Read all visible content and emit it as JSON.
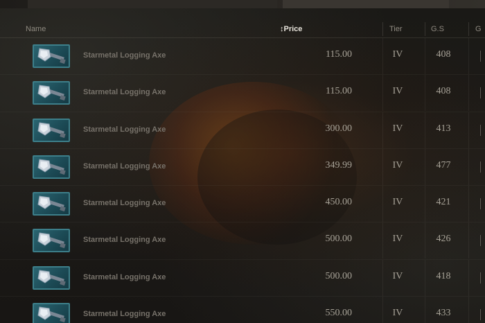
{
  "columns": {
    "name": "Name",
    "price": "Price",
    "price_sort_icon": "sort-arrows-icon",
    "tier": "Tier",
    "gs": "G.S",
    "extra": "G"
  },
  "item_icon": "axe-icon",
  "colors": {
    "icon_border": "#3d7f8a",
    "icon_bg": "#1c4a55",
    "text": "#a8a398",
    "name_text": "#77726a"
  },
  "rows": [
    {
      "name": "Starmetal Logging Axe",
      "price": "115.00",
      "tier": "IV",
      "gs": "408"
    },
    {
      "name": "Starmetal Logging Axe",
      "price": "115.00",
      "tier": "IV",
      "gs": "408"
    },
    {
      "name": "Starmetal Logging Axe",
      "price": "300.00",
      "tier": "IV",
      "gs": "413"
    },
    {
      "name": "Starmetal Logging Axe",
      "price": "349.99",
      "tier": "IV",
      "gs": "477"
    },
    {
      "name": "Starmetal Logging Axe",
      "price": "450.00",
      "tier": "IV",
      "gs": "421"
    },
    {
      "name": "Starmetal Logging Axe",
      "price": "500.00",
      "tier": "IV",
      "gs": "426"
    },
    {
      "name": "Starmetal Logging Axe",
      "price": "500.00",
      "tier": "IV",
      "gs": "418"
    },
    {
      "name": "Starmetal Logging Axe",
      "price": "550.00",
      "tier": "IV",
      "gs": "433"
    }
  ]
}
